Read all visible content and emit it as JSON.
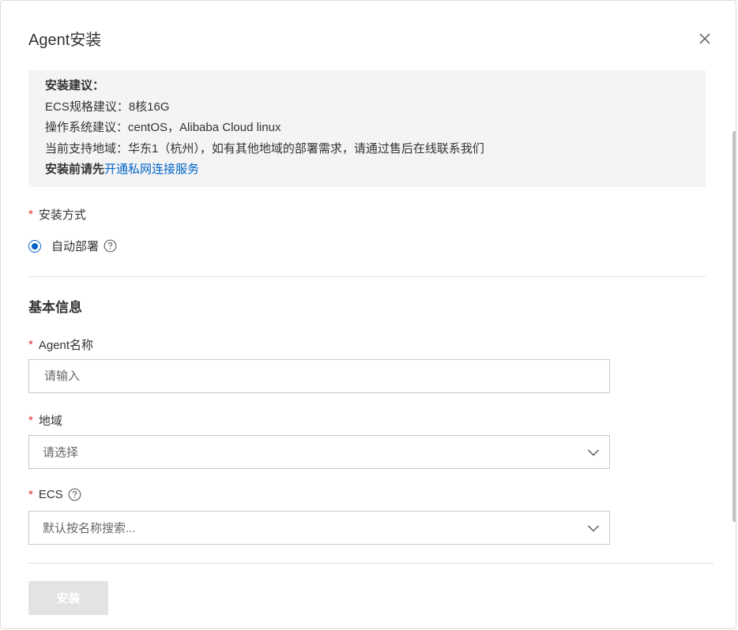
{
  "dialog": {
    "title": "Agent安装"
  },
  "notice": {
    "heading": "安装建议：",
    "line_ecs": "ECS规格建议：8核16G",
    "line_os": "操作系统建议：centOS，Alibaba Cloud linux",
    "line_region": "当前支持地域：华东1（杭州），如有其他地域的部署需求，请通过售后在线联系我们",
    "pre_link": "安装前请先",
    "link": "开通私网连接服务"
  },
  "install_method": {
    "required_mark": "*",
    "label": "安装方式",
    "option": "自动部署",
    "selected": true
  },
  "basic_info": {
    "title": "基本信息"
  },
  "agent_name": {
    "required_mark": "*",
    "label": "Agent名称",
    "placeholder": "请输入",
    "value": ""
  },
  "region": {
    "required_mark": "*",
    "label": "地域",
    "placeholder": "请选择"
  },
  "ecs": {
    "required_mark": "*",
    "label": "ECS",
    "placeholder": "默认按名称搜索..."
  },
  "footer": {
    "install_label": "安装"
  },
  "colors": {
    "accent": "#0064c8",
    "required": "#d93026",
    "notice_bg": "#f4f4f5",
    "disabled_button": "#e3e3e3"
  },
  "icons": {
    "close": "close-icon",
    "help": "question-circle-icon",
    "dropdown": "chevron-down-icon"
  }
}
